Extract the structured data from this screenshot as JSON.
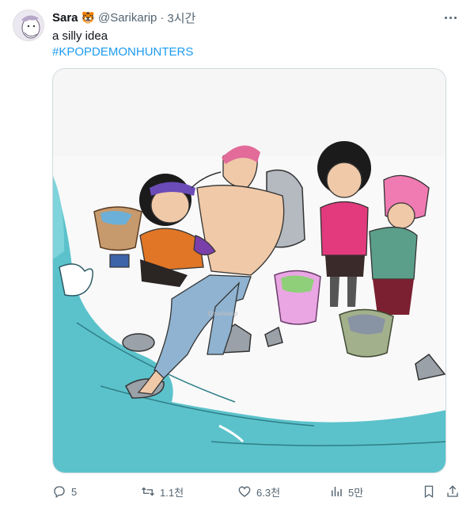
{
  "tweet": {
    "display_name": "Sara",
    "name_emoji": "🐯",
    "handle": "@Sarikarip",
    "separator": "·",
    "time": "3시간",
    "text": "a silly idea",
    "hashtag": "#KPOPDEMONHUNTERS",
    "more_icon": "more-horizontal-icon"
  },
  "media": {
    "watermark": "@sarikarip"
  },
  "actions": {
    "reply_count": "5",
    "retweet_count": "1.1천",
    "like_count": "6.3천",
    "views_count": "5만"
  },
  "colors": {
    "accent": "#1d9bf0",
    "muted": "#536471",
    "water": "#5bc2cb"
  }
}
